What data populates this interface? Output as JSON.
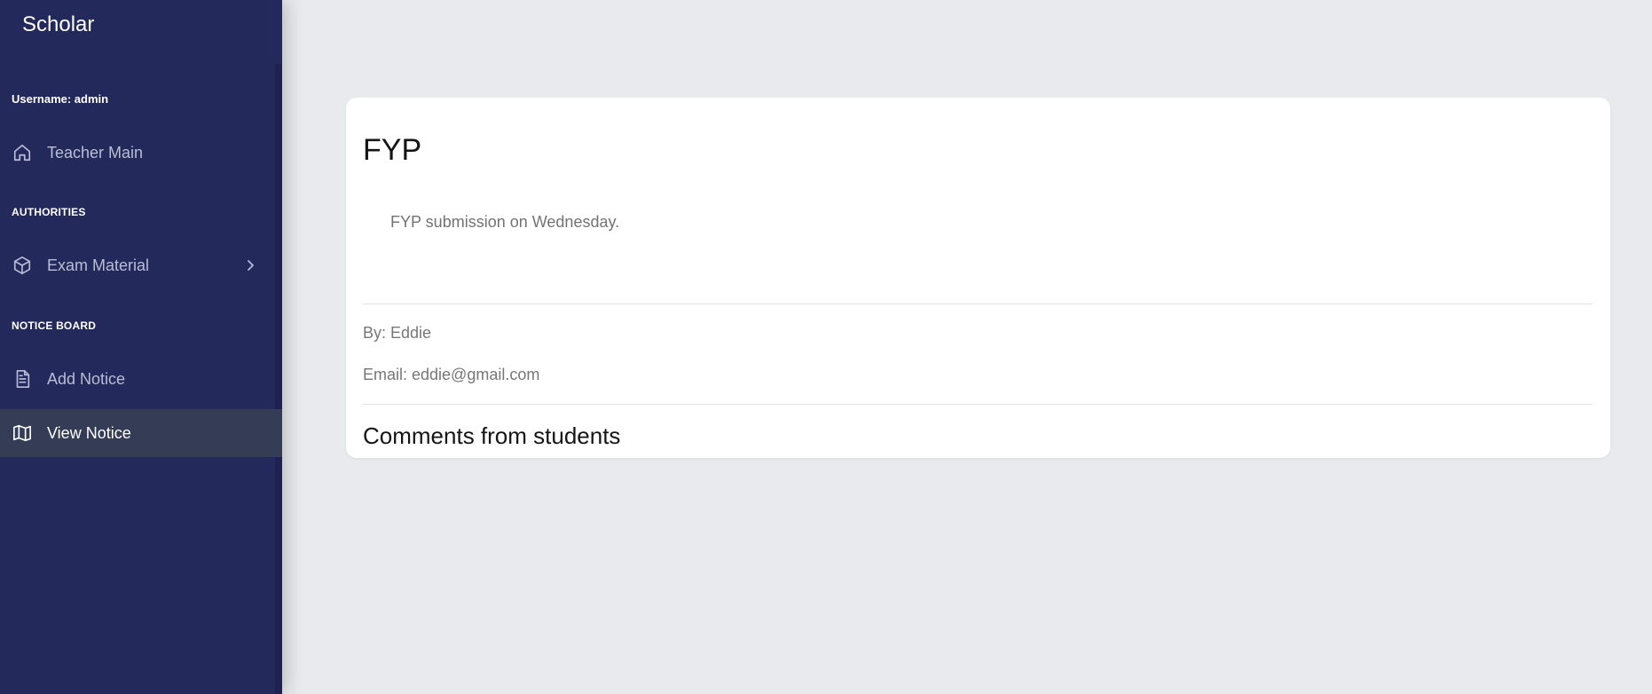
{
  "app": {
    "brand": "Scholar",
    "username": "Username: admin"
  },
  "sidebar": {
    "items": [
      {
        "label": "Teacher Main",
        "icon": "home-icon"
      },
      {
        "label": "Exam Material",
        "icon": "cube-icon"
      },
      {
        "label": "Add Notice",
        "icon": "document-icon"
      },
      {
        "label": "View Notice",
        "icon": "map-icon",
        "active": true
      }
    ],
    "sections": {
      "authorities": "AUTHORITIES",
      "notice_board": "NOTICE BOARD"
    }
  },
  "notice": {
    "title": "FYP",
    "body": "FYP submission on Wednesday.",
    "author": "By: Eddie",
    "email": "Email: eddie@gmail.com",
    "comments_heading": "Comments from students"
  },
  "colors": {
    "sidebar_bg": "#24295c",
    "active_item_bg": "#353d56",
    "page_bg": "#e9eaee",
    "card_bg": "#ffffff"
  }
}
